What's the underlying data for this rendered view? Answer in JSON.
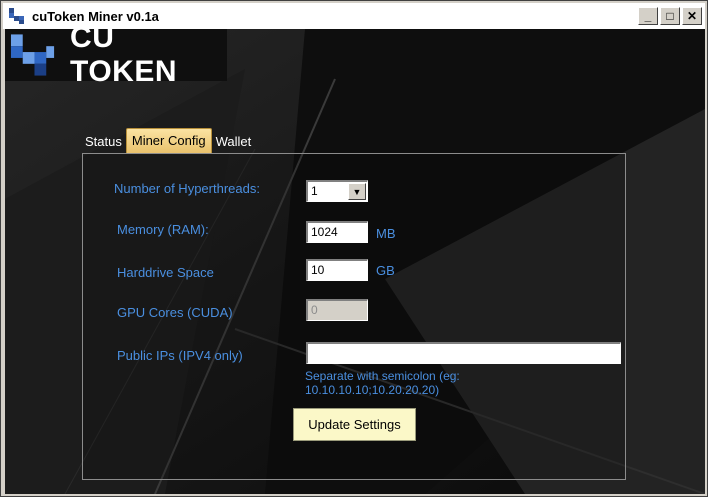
{
  "window": {
    "title": "cuToken Miner v0.1a",
    "controls": [
      "minimize",
      "maximize",
      "close"
    ]
  },
  "logo": {
    "text": "CU TOKEN"
  },
  "tabs": [
    {
      "label": "Status",
      "active": false
    },
    {
      "label": "Miner Config",
      "active": true
    },
    {
      "label": "Wallet",
      "active": false
    }
  ],
  "config": {
    "hyperthreads": {
      "label": "Number of Hyperthreads:",
      "value": "1"
    },
    "memory": {
      "label": "Memory (RAM):",
      "value": "1024",
      "unit": "MB"
    },
    "harddrive": {
      "label": "Harddrive Space",
      "value": "10",
      "unit": "GB"
    },
    "gpu": {
      "label": "GPU Cores (CUDA)",
      "value": "0",
      "disabled": true
    },
    "public_ips": {
      "label": "Public IPs (IPV4 only)",
      "value": "",
      "hint_line1": "Separate with semicolon (eg:",
      "hint_line2": "10.10.10.10;10.20.20.20)"
    },
    "update_button": "Update Settings"
  },
  "colors": {
    "label_blue": "#4a8fe0",
    "active_tab": "#f0ca78",
    "button_bg": "#fbf8c8"
  }
}
